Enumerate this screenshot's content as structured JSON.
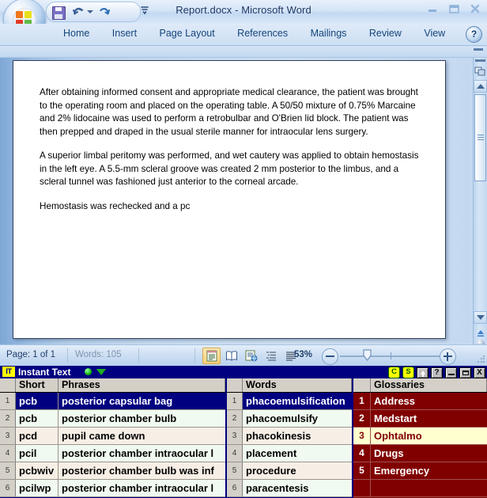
{
  "word": {
    "title": "Report.docx - Microsoft Word",
    "orb_icon": "office-orb-icon",
    "quick_access": {
      "save_icon": "save-icon",
      "undo_icon": "undo-icon",
      "undo_dropdown_icon": "chevron-down-icon",
      "redo_icon": "redo-icon",
      "customize_icon": "customize-toolbar-icon"
    },
    "window_controls": {
      "minimize": "minimize-icon",
      "maximize": "maximize-icon",
      "close": "close-icon"
    },
    "ribbon_tabs": [
      "Home",
      "Insert",
      "Page Layout",
      "References",
      "Mailings",
      "Review",
      "View"
    ],
    "help_label": "?",
    "document": {
      "paragraphs": [
        "After obtaining informed consent and appropriate medical clearance, the patient was brought to the operating room and placed on the operating table.  A 50/50 mixture of 0.75% Marcaine and 2% lidocaine was used to perform a retrobulbar and O'Brien lid block.  The patient was then prepped and draped in the usual sterile manner for intraocular lens surgery.",
        "A superior limbal peritomy was performed, and wet cautery was applied to obtain hemostasis in the left eye.  A 5.5-mm scleral groove was created 2 mm posterior to the limbus, and a scleral tunnel was fashioned just anterior to the corneal arcade.",
        "Hemostasis was rechecked and a pc"
      ]
    },
    "scrollbar": {
      "split_icon": "split-window-icon",
      "up_icon": "scroll-up-icon",
      "down_icon": "scroll-down-icon",
      "thumb_icon": "scroll-thumb",
      "previous_icon": "previous-page-icon",
      "select_object_icon": "select-browse-object-icon",
      "next_icon": "next-page-icon"
    },
    "status_bar": {
      "page": "Page: 1 of 1",
      "words": "Words: 105",
      "view_buttons": [
        {
          "name": "print-layout-view-icon",
          "active": true
        },
        {
          "name": "full-screen-reading-view-icon",
          "active": false
        },
        {
          "name": "web-layout-view-icon",
          "active": false
        },
        {
          "name": "outline-view-icon",
          "active": false
        },
        {
          "name": "draft-view-icon",
          "active": false
        }
      ],
      "zoom_level": "53%",
      "zoom_out_icon": "zoom-out-icon",
      "zoom_in_icon": "zoom-in-icon",
      "resize_grip_icon": "resize-grip-icon"
    }
  },
  "instant_text": {
    "logo_text": "IT",
    "title": "Instant Text",
    "status_dot_icon": "green-status-dot-icon",
    "caret_icon": "green-caret-down-icon",
    "titlebar_buttons": [
      {
        "name": "correction-button",
        "label": "C"
      },
      {
        "name": "spelling-button",
        "label": "S"
      },
      {
        "name": "always-on-top-button",
        "label": ""
      },
      {
        "name": "help-button",
        "label": "?"
      },
      {
        "name": "minimize-button",
        "label": ""
      },
      {
        "name": "maximize-button",
        "label": ""
      },
      {
        "name": "close-button",
        "label": "X"
      }
    ],
    "close_label": "X",
    "phrases_panel": {
      "headers": {
        "num": "",
        "short": "Short",
        "phrase": "Phrases"
      },
      "rows": [
        {
          "num": "1",
          "short": "pcb",
          "phrase": "posterior capsular bag",
          "selected": true
        },
        {
          "num": "2",
          "short": "pcb",
          "phrase": "posterior chamber bulb",
          "selected": false
        },
        {
          "num": "3",
          "short": "pcd",
          "phrase": "pupil came down",
          "selected": false
        },
        {
          "num": "4",
          "short": "pcil",
          "phrase": "posterior chamber intraocular l",
          "selected": false
        },
        {
          "num": "5",
          "short": "pcbwiv",
          "phrase": "posterior chamber bulb was inf",
          "selected": false
        },
        {
          "num": "6",
          "short": "pcilwp",
          "phrase": "posterior chamber intraocular l",
          "selected": false
        }
      ]
    },
    "words_panel": {
      "headers": {
        "num": "",
        "word": "Words"
      },
      "rows": [
        {
          "num": "1",
          "word": "phacoemulsification",
          "selected": true
        },
        {
          "num": "2",
          "word": "phacoemulsify",
          "selected": false
        },
        {
          "num": "3",
          "word": "phacokinesis",
          "selected": false
        },
        {
          "num": "4",
          "word": "placement",
          "selected": false
        },
        {
          "num": "5",
          "word": "procedure",
          "selected": false
        },
        {
          "num": "6",
          "word": "paracentesis",
          "selected": false
        }
      ]
    },
    "glossaries_panel": {
      "headers": {
        "num": "",
        "gloss": "Glossaries"
      },
      "rows": [
        {
          "num": "1",
          "gloss": "Address",
          "highlighted": false
        },
        {
          "num": "2",
          "gloss": "Medstart",
          "highlighted": false
        },
        {
          "num": "3",
          "gloss": "Ophtalmo",
          "highlighted": true
        },
        {
          "num": "4",
          "gloss": "Drugs",
          "highlighted": false
        },
        {
          "num": "5",
          "gloss": "Emergency",
          "highlighted": false
        },
        {
          "num": "",
          "gloss": "",
          "highlighted": false
        }
      ]
    }
  },
  "colors": {
    "it_titlebar": "#000080",
    "glossary_bg": "#800000",
    "glossary_highlight": "#ffffd0",
    "selection": "#000080",
    "word_blue": "#14457c"
  }
}
